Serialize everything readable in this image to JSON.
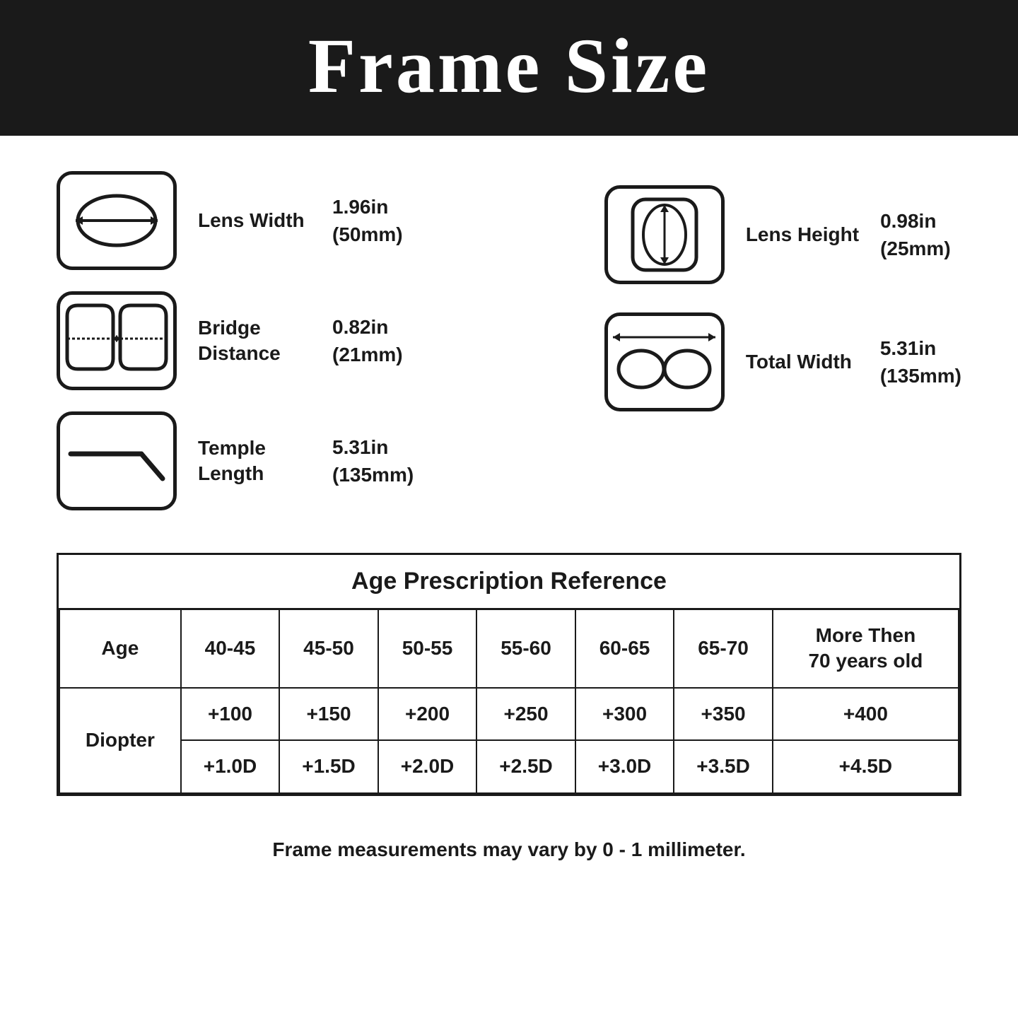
{
  "header": {
    "title": "Frame Size"
  },
  "specs": {
    "left": [
      {
        "id": "lens-width",
        "label": "Lens Width",
        "value": "1.96in\n(50mm)",
        "icon": "lens-width-icon"
      },
      {
        "id": "bridge-distance",
        "label": "Bridge\nDistance",
        "value": "0.82in\n(21mm)",
        "icon": "bridge-distance-icon"
      },
      {
        "id": "temple-length",
        "label": "Temple\nLength",
        "value": "5.31in\n(135mm)",
        "icon": "temple-length-icon"
      }
    ],
    "right": [
      {
        "id": "lens-height",
        "label": "Lens Height",
        "value": "0.98in\n(25mm)",
        "icon": "lens-height-icon"
      },
      {
        "id": "total-width",
        "label": "Total Width",
        "value": "5.31in\n(135mm)",
        "icon": "total-width-icon"
      }
    ]
  },
  "table": {
    "title": "Age Prescription Reference",
    "headers": [
      "Age",
      "40-45",
      "45-50",
      "50-55",
      "55-60",
      "60-65",
      "65-70",
      "More Then\n70 years old"
    ],
    "rows": [
      {
        "row_header": "Diopter",
        "row1": [
          "+100",
          "+150",
          "+200",
          "+250",
          "+300",
          "+350",
          "+400"
        ],
        "row2": [
          "+1.0D",
          "+1.5D",
          "+2.0D",
          "+2.5D",
          "+3.0D",
          "+3.5D",
          "+4.5D"
        ]
      }
    ]
  },
  "footer": {
    "note": "Frame measurements may vary by 0 - 1 millimeter."
  }
}
